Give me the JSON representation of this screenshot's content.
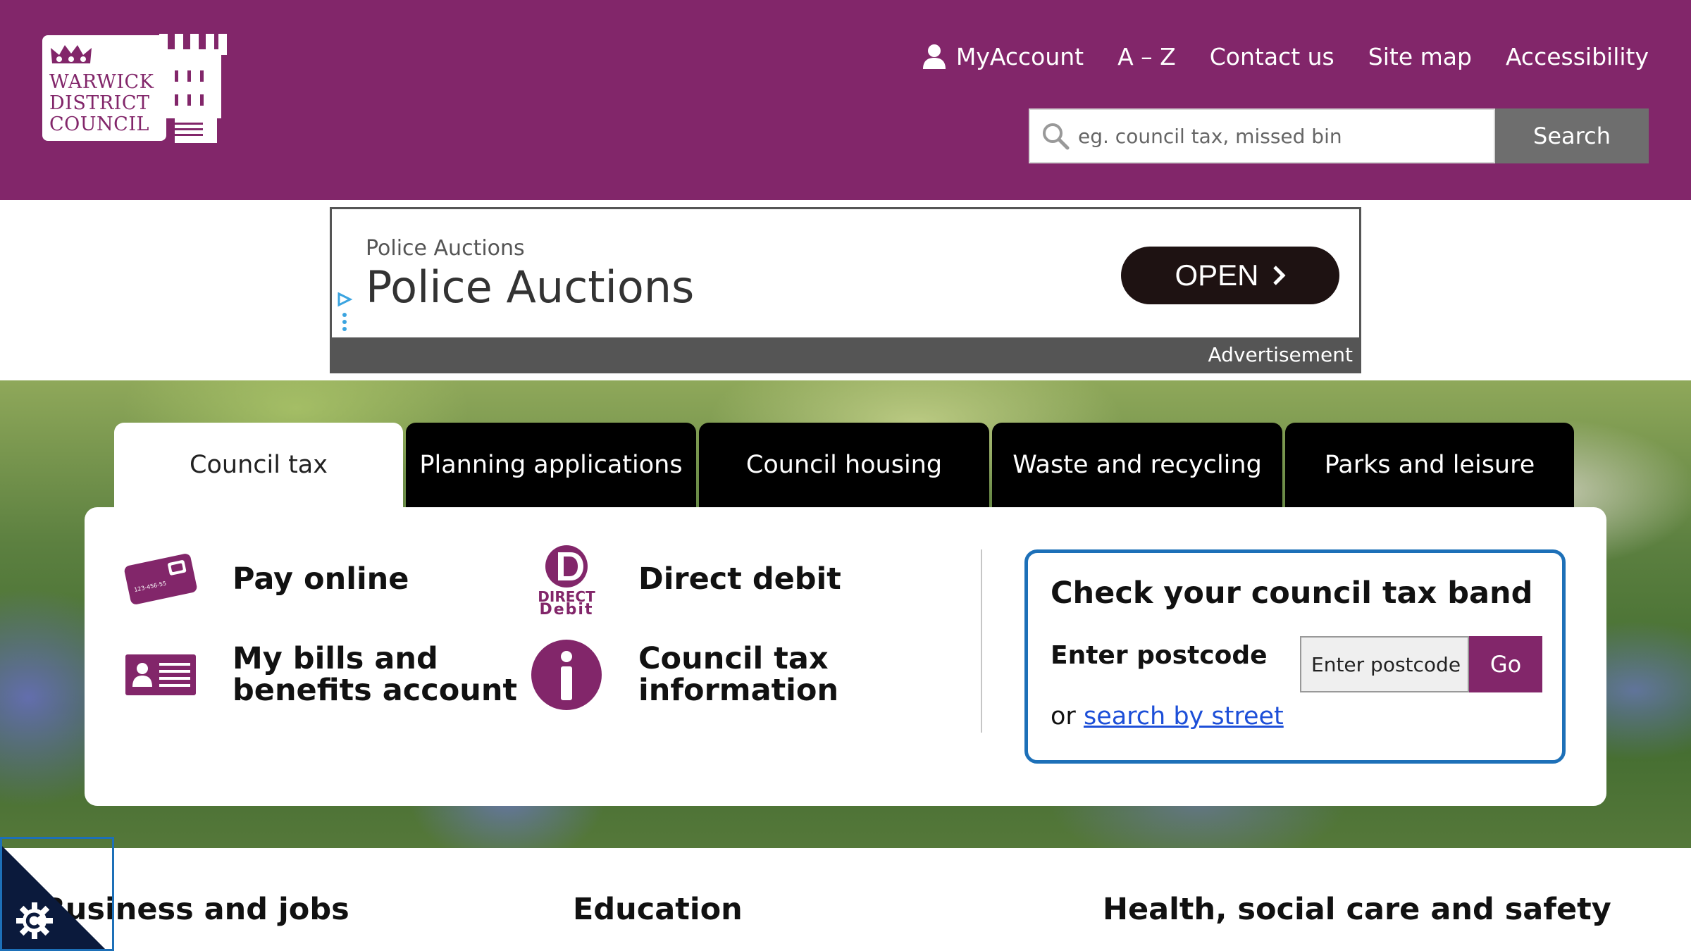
{
  "logo": {
    "line1": "WARWICK",
    "line2": "DISTRICT",
    "line3": "COUNCIL"
  },
  "topnav": {
    "myaccount": "MyAccount",
    "az": "A – Z",
    "contact": "Contact us",
    "sitemap": "Site map",
    "accessibility": "Accessibility"
  },
  "search": {
    "placeholder": "eg. council tax, missed bin",
    "button": "Search"
  },
  "ad": {
    "brand": "Police Auctions",
    "headline": "Police Auctions",
    "cta": "OPEN",
    "label": "Advertisement"
  },
  "tabs": [
    {
      "label": "Council tax",
      "active": true
    },
    {
      "label": "Planning applications",
      "active": false
    },
    {
      "label": "Council housing",
      "active": false
    },
    {
      "label": "Waste and recycling",
      "active": false
    },
    {
      "label": "Parks and leisure",
      "active": false
    }
  ],
  "tasks": {
    "pay_online": "Pay online",
    "direct_debit": "Direct debit",
    "bills_line1": "My bills and",
    "bills_line2": "benefits account",
    "info_line1": "Council tax",
    "info_line2": "information",
    "card_number": "123-456-55",
    "dd_logo_line1": "DIRECT",
    "dd_logo_line2": "Debit"
  },
  "band_check": {
    "title": "Check your council tax band",
    "postcode_label": "Enter postcode",
    "input_placeholder": "Enter postcode",
    "go": "Go",
    "or_text": "or",
    "street_link": "search by street"
  },
  "services": [
    "Business and jobs",
    "Education",
    "Health, social care and safety"
  ],
  "colors": {
    "brand_purple": "#82266a",
    "focus_blue": "#1d70b8",
    "link_blue": "#1d4fd8",
    "tab_black": "#000000",
    "search_button_grey": "#6e6e6e"
  }
}
